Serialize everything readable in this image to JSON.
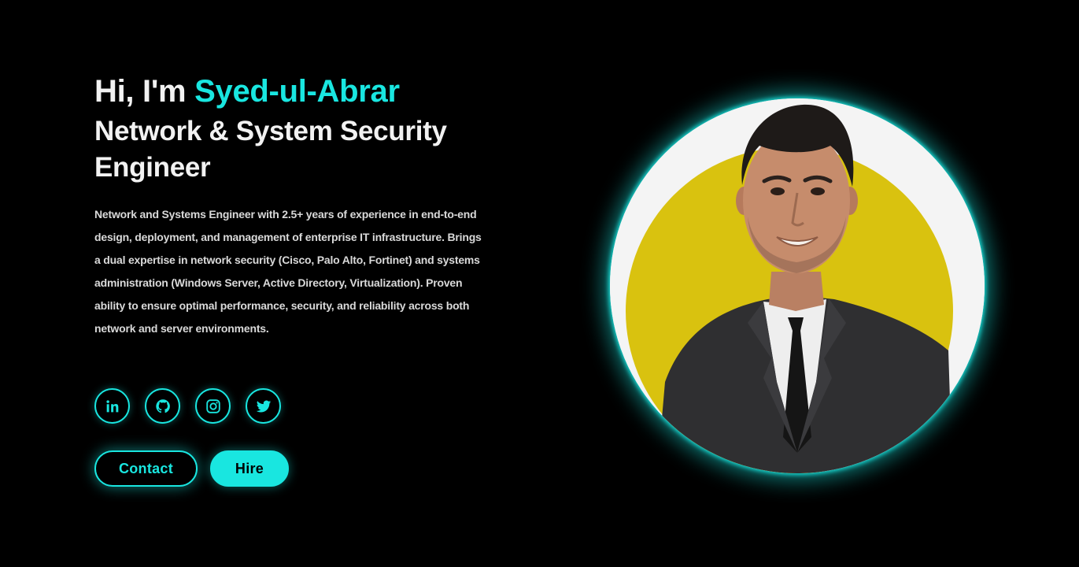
{
  "hero": {
    "greeting_prefix": "Hi, I'm ",
    "name": "Syed-ul-Abrar",
    "role": "Network & System Security Engineer",
    "bio": "Network and Systems Engineer with 2.5+ years of experience in end-to-end design, deployment, and management of enterprise IT infrastructure. Brings a dual expertise in network security (Cisco, Palo Alto, Fortinet) and systems administration (Windows Server, Active Directory, Virtualization). Proven ability to ensure optimal performance, security, and reliability across both network and server environments."
  },
  "socials": [
    {
      "icon": "linkedin-icon"
    },
    {
      "icon": "github-icon"
    },
    {
      "icon": "instagram-icon"
    },
    {
      "icon": "twitter-icon"
    }
  ],
  "actions": {
    "contact_label": "Contact",
    "hire_label": "Hire"
  },
  "profile_photo": {
    "icon": "profile-photo"
  },
  "colors": {
    "background": "#000000",
    "accent": "#19e6e0",
    "text": "#f2f2f2",
    "photo_backdrop": "#d9c20f"
  }
}
